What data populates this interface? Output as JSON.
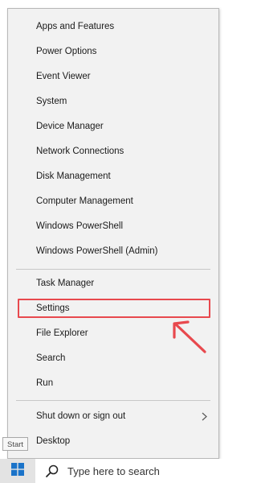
{
  "menu": {
    "group1": [
      {
        "label": "Apps and Features"
      },
      {
        "label": "Power Options"
      },
      {
        "label": "Event Viewer"
      },
      {
        "label": "System"
      },
      {
        "label": "Device Manager"
      },
      {
        "label": "Network Connections"
      },
      {
        "label": "Disk Management"
      },
      {
        "label": "Computer Management"
      },
      {
        "label": "Windows PowerShell"
      },
      {
        "label": "Windows PowerShell (Admin)"
      }
    ],
    "group2": [
      {
        "label": "Task Manager"
      },
      {
        "label": "Settings"
      },
      {
        "label": "File Explorer"
      },
      {
        "label": "Search"
      },
      {
        "label": "Run"
      }
    ],
    "group3": [
      {
        "label": "Shut down or sign out",
        "icon": "chevron-right-icon"
      },
      {
        "label": "Desktop"
      }
    ]
  },
  "annotation": {
    "highlighted_item": "Settings",
    "color": "#e8494e",
    "icon": "red-arrow-icon"
  },
  "tooltip": {
    "text": "Start"
  },
  "taskbar": {
    "start_icon": "windows-logo-icon",
    "start_color": "#1a73c9",
    "search_icon": "search-icon",
    "search_placeholder": "Type here to search"
  }
}
